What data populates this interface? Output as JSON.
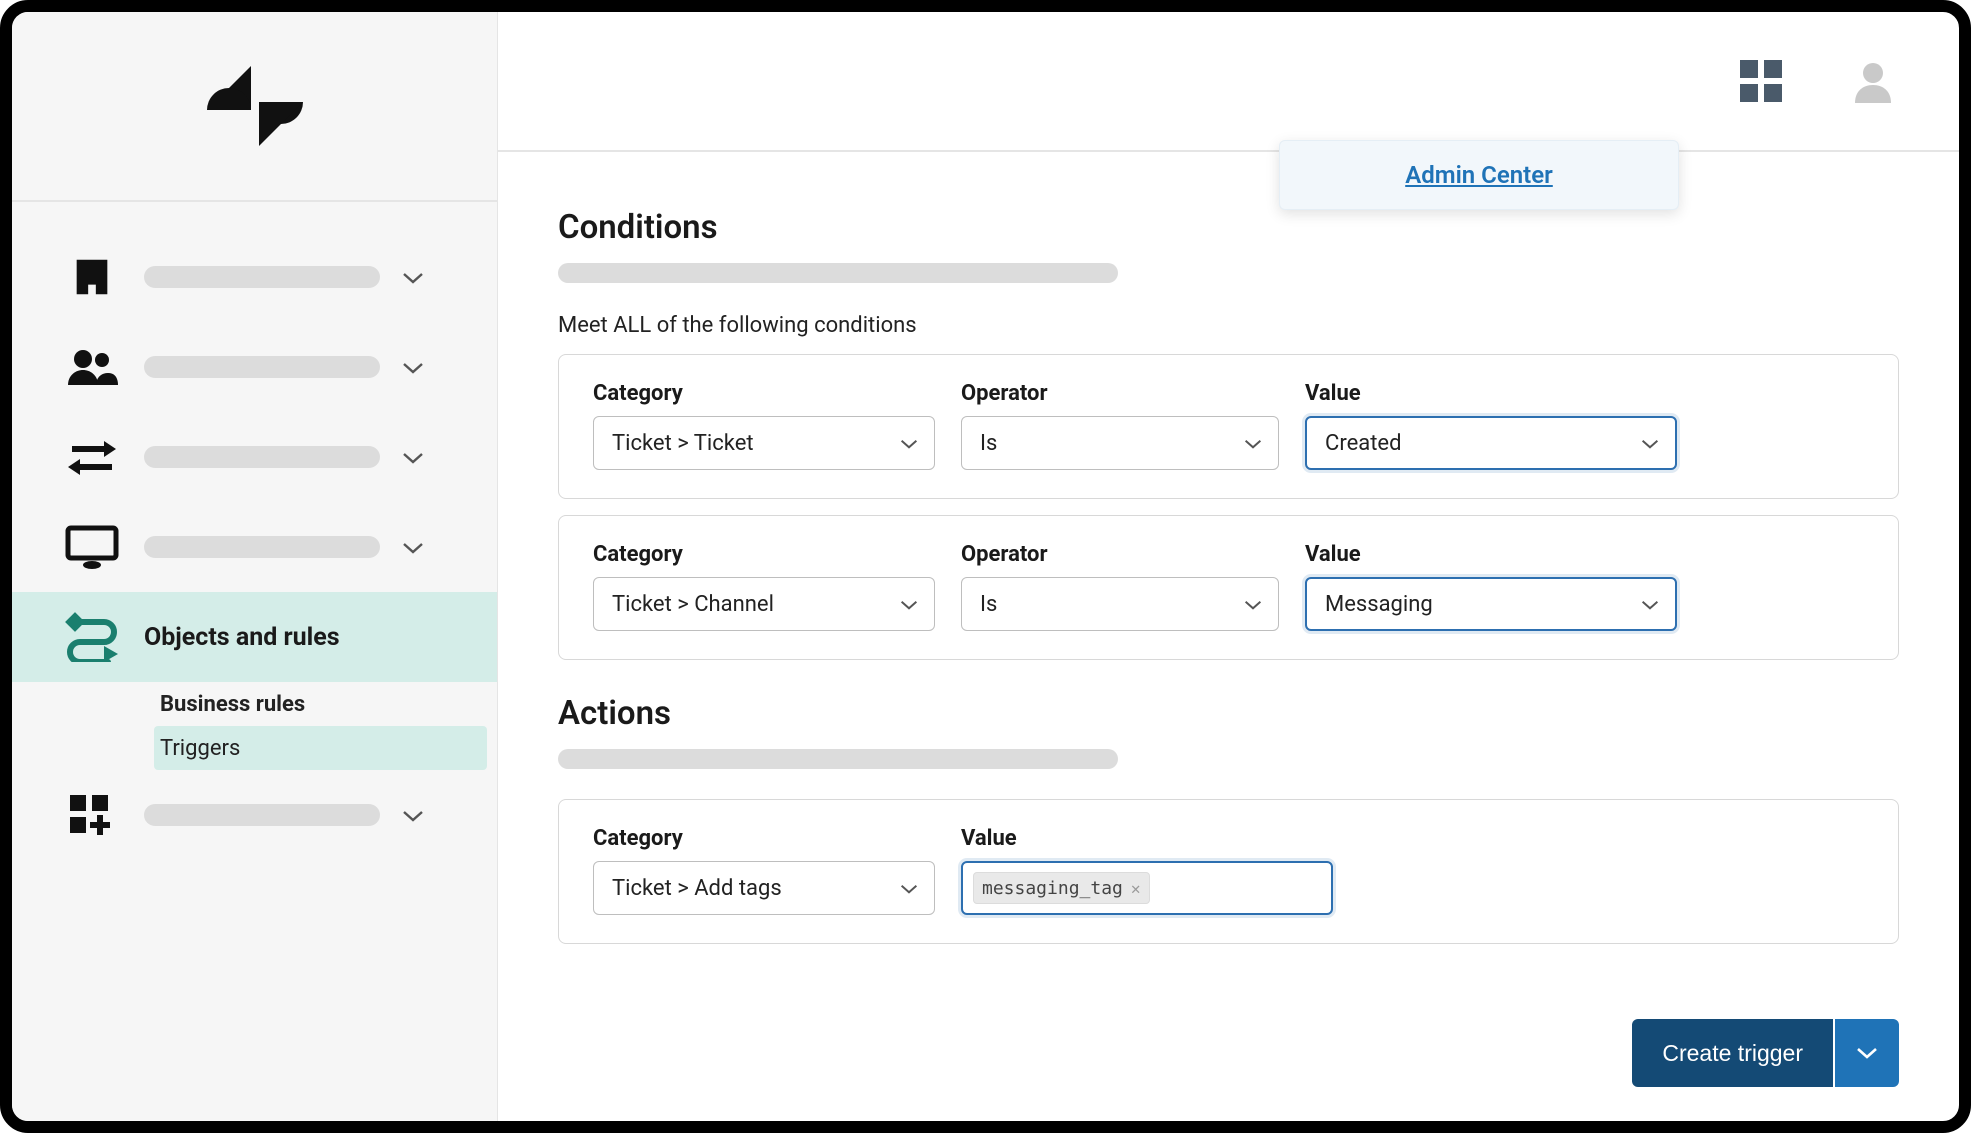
{
  "popover": {
    "label": "Admin Center"
  },
  "sidebar": {
    "active": {
      "label": "Objects and rules"
    },
    "sub": {
      "heading": "Business rules",
      "item": "Triggers"
    }
  },
  "page": {
    "sections": {
      "conditions": "Conditions",
      "actions": "Actions"
    },
    "instructions": "Meet ALL of the following conditions",
    "labels": {
      "category": "Category",
      "operator": "Operator",
      "value": "Value"
    }
  },
  "conditions": [
    {
      "category": "Ticket > Ticket",
      "operator": "Is",
      "value": "Created"
    },
    {
      "category": "Ticket > Channel",
      "operator": "Is",
      "value": "Messaging"
    }
  ],
  "actions": [
    {
      "category": "Ticket > Add tags",
      "tag": "messaging_tag"
    }
  ],
  "footer": {
    "create": "Create trigger"
  }
}
